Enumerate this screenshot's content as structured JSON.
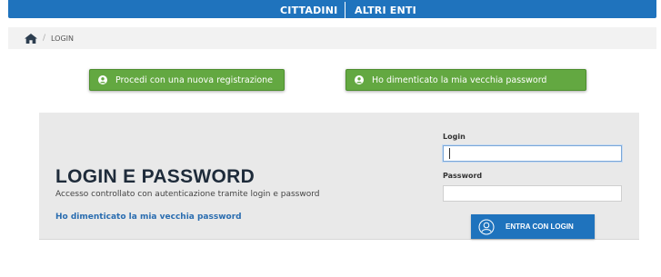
{
  "top_nav": {
    "cittadini": "CITTADINI",
    "altri_enti": "ALTRI ENTI"
  },
  "breadcrumb": {
    "home_icon": "home-icon",
    "separator": "/",
    "current": "LOGIN"
  },
  "actions": {
    "new_registration": "Procedi con una nuova registrazione",
    "forgot_password": "Ho dimenticato la mia vecchia password",
    "icon": "user-circle-icon"
  },
  "login_panel": {
    "title": "LOGIN E PASSWORD",
    "subtitle": "Accesso controllato con autenticazione tramite login e password",
    "forgot_link": "Ho dimenticato la mia vecchia password",
    "login_label": "Login",
    "login_value": "",
    "password_label": "Password",
    "password_value": "",
    "submit_label": "ENTRA CON LOGIN",
    "submit_icon": "user-circle-icon"
  },
  "colors": {
    "primary_blue": "#1f73bd",
    "green": "#63a841",
    "link_blue": "#2a6db0",
    "panel_bg": "#e9e9e9"
  }
}
